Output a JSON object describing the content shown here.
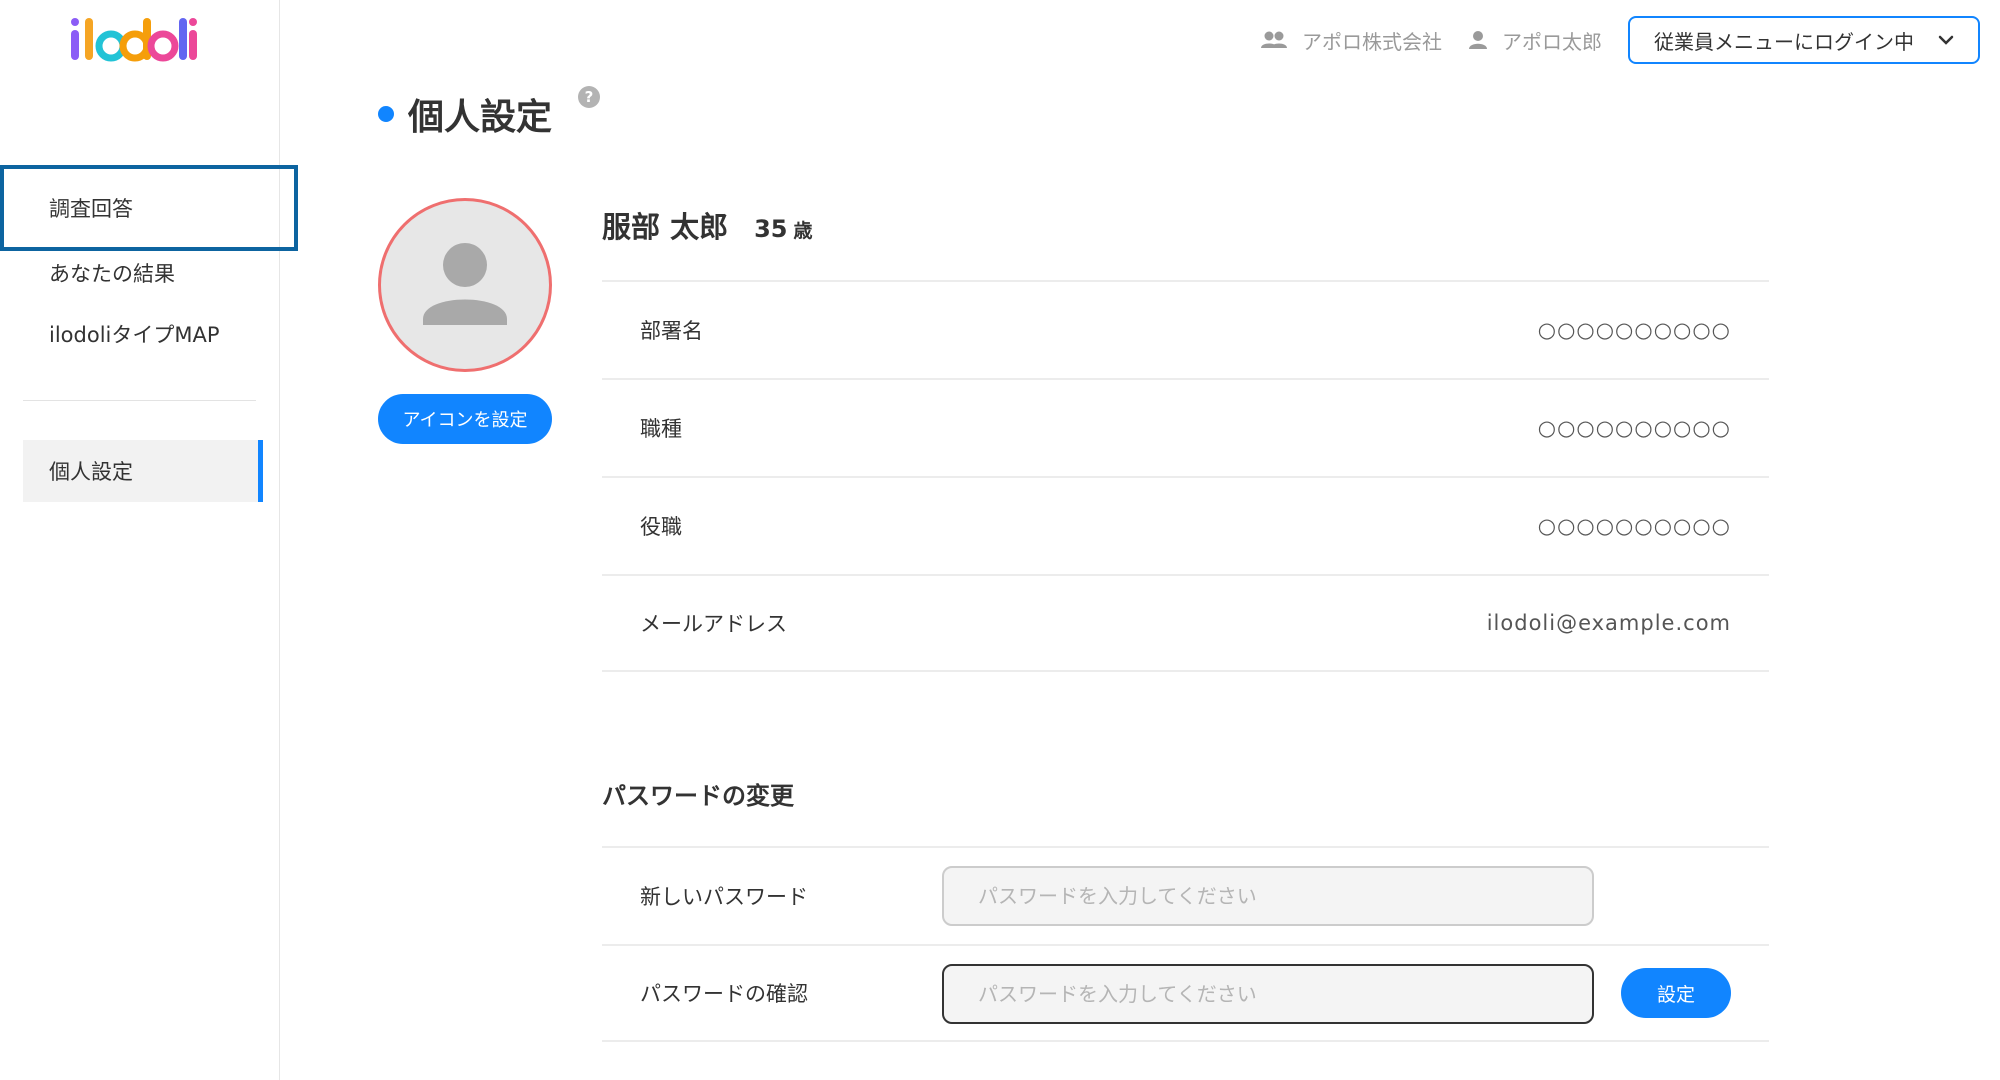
{
  "app": {
    "logo_text": "ilodoli"
  },
  "colors": {
    "accent": "#1185ff",
    "avatar_ring": "#ef6f6f",
    "highlight_border": "#0d64a0"
  },
  "sidebar": {
    "items": [
      {
        "label": "調査回答"
      },
      {
        "label": "あなたの結果"
      },
      {
        "label": "ilodoliタイプMAP"
      }
    ],
    "settings_item": {
      "label": "個人設定"
    }
  },
  "header": {
    "company": "アポロ株式会社",
    "user": "アポロ太郎",
    "login_menu": "従業員メニューにログイン中"
  },
  "page": {
    "title": "個人設定",
    "help_icon": "?"
  },
  "profile": {
    "set_icon_label": "アイコンを設定",
    "name": "服部 太郎",
    "age": "35",
    "age_unit": "歳",
    "rows": [
      {
        "label": "部署名",
        "value": "○○○○○○○○○○"
      },
      {
        "label": "職種",
        "value": "○○○○○○○○○○"
      },
      {
        "label": "役職",
        "value": "○○○○○○○○○○"
      },
      {
        "label": "メールアドレス",
        "value": "ilodoli@example.com"
      }
    ]
  },
  "password": {
    "heading": "パスワードの変更",
    "new_label": "新しいパスワード",
    "confirm_label": "パスワードの確認",
    "placeholder": "パスワードを入力してください",
    "submit_label": "設定"
  }
}
